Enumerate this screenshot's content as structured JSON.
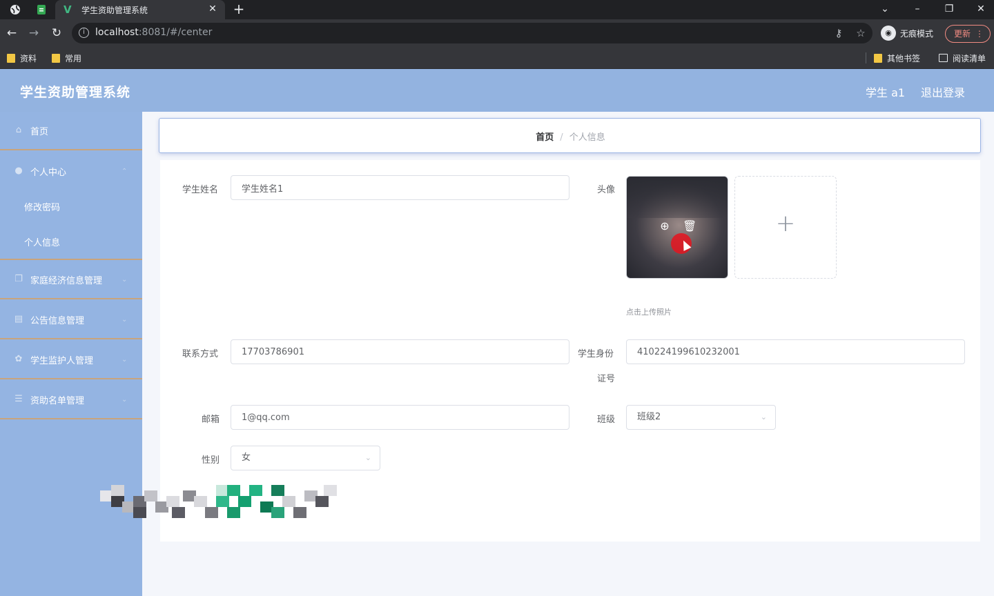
{
  "browser": {
    "tab_title": "学生资助管理系统",
    "url_host": "localhost",
    "url_rest": ":8081/#/center",
    "incognito_label": "无痕模式",
    "update_label": "更新",
    "bookmarks": [
      "资料",
      "常用"
    ],
    "bookmarks_right": [
      "其他书签",
      "阅读清单"
    ]
  },
  "header": {
    "app_title": "学生资助管理系统",
    "user": "学生 a1",
    "logout": "退出登录"
  },
  "sidebar": {
    "items": [
      {
        "label": "首页",
        "icon": "home-icon"
      },
      {
        "label": "个人中心",
        "icon": "user-icon"
      },
      {
        "label": "家庭经济信息管理",
        "icon": "document-icon"
      },
      {
        "label": "公告信息管理",
        "icon": "notice-icon"
      },
      {
        "label": "学生监护人管理",
        "icon": "guardian-icon"
      },
      {
        "label": "资助名单管理",
        "icon": "list-icon"
      }
    ],
    "subitems": [
      "修改密码",
      "个人信息"
    ]
  },
  "breadcrumb": {
    "home": "首页",
    "separator": "/",
    "current": "个人信息"
  },
  "form": {
    "name_label": "学生姓名",
    "name_value": "学生姓名1",
    "avatar_label": "头像",
    "upload_tip": "点击上传照片",
    "phone_label": "联系方式",
    "phone_value": "17703786901",
    "idcard_label_1": "学生身份",
    "idcard_label_2": "证号",
    "idcard_value": "410224199610232001",
    "email_label": "邮箱",
    "email_value": "1@qq.com",
    "class_label": "班级",
    "class_value": "班级2",
    "gender_label": "性别",
    "gender_value": "女"
  },
  "colors": {
    "header_bg": "#93b3e0",
    "sidebar_bg": "#94b4e2",
    "menu_divider": "#c9a47c",
    "accent_green": "#41b883"
  }
}
